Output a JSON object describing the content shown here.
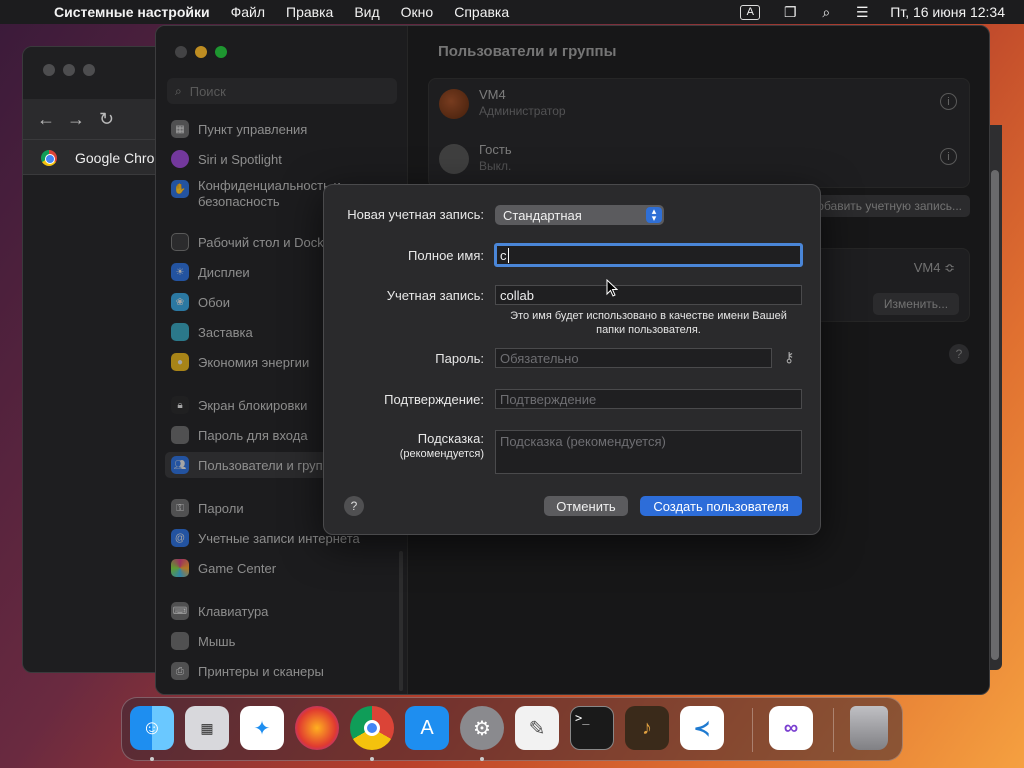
{
  "menubar": {
    "app_name": "Системные настройки",
    "items": [
      "Файл",
      "Правка",
      "Вид",
      "Окно",
      "Справка"
    ],
    "keyboard_badge": "A",
    "clock": "Пт, 16 июня  12:34"
  },
  "chrome_window": {
    "tab_title": "Google Chrom"
  },
  "sidebar": {
    "search_placeholder": "Поиск",
    "items": [
      {
        "label": "Пункт управления",
        "icon": "control-center-icon",
        "color": "#6b6b6d"
      },
      {
        "label": "Siri и Spotlight",
        "icon": "siri-icon",
        "color": "#9a4bd0"
      },
      {
        "label": "Конфиденциальность и",
        "label2": "безопасность",
        "icon": "hand-icon",
        "color": "#2f6fd6"
      },
      {
        "label": "Рабочий стол и Dock",
        "icon": "desktop-icon",
        "color": "#3a3a3c"
      },
      {
        "label": "Дисплеи",
        "icon": "display-icon",
        "color": "#2f6fd6"
      },
      {
        "label": "Обои",
        "icon": "wallpaper-icon",
        "color": "#3aa0d8"
      },
      {
        "label": "Заставка",
        "icon": "screensaver-icon",
        "color": "#3aa0b8"
      },
      {
        "label": "Экономия энергии",
        "icon": "energy-icon",
        "color": "#e0b020"
      },
      {
        "label": "Экран блокировки",
        "icon": "lock-icon",
        "color": "#2b2b2d"
      },
      {
        "label": "Пароль для входа",
        "icon": "login-password-icon",
        "color": "#6b6b6d"
      },
      {
        "label": "Пользователи и группы",
        "icon": "users-icon",
        "color": "#2f6fd6"
      },
      {
        "label": "Пароли",
        "icon": "key-icon",
        "color": "#6b6b6d"
      },
      {
        "label": "Учетные записи интернета",
        "icon": "at-icon",
        "color": "#2f6fd6"
      },
      {
        "label": "Game Center",
        "icon": "game-center-icon",
        "color": "#d04080"
      },
      {
        "label": "Клавиатура",
        "icon": "keyboard-icon",
        "color": "#6b6b6d"
      },
      {
        "label": "Мышь",
        "icon": "mouse-icon",
        "color": "#6b6b6d"
      },
      {
        "label": "Принтеры и сканеры",
        "icon": "printer-icon",
        "color": "#6b6b6d"
      }
    ]
  },
  "main": {
    "title": "Пользователи и группы",
    "users": [
      {
        "name": "VM4",
        "role": "Администратор"
      },
      {
        "name": "Гость",
        "role": "Выкл."
      }
    ],
    "add_account_label": "Добавить учетную запись...",
    "autologin_value": "VM4 ≎",
    "edit_button": "Изменить..."
  },
  "dialog": {
    "account_type_label": "Новая учетная запись:",
    "account_type_value": "Стандартная",
    "full_name_label": "Полное имя:",
    "full_name_value": "c",
    "account_name_label": "Учетная запись:",
    "account_name_value": "collab",
    "account_note": "Это имя будет использовано в качестве имени Вашей папки пользователя.",
    "password_label": "Пароль:",
    "password_placeholder": "Обязательно",
    "verify_label": "Подтверждение:",
    "verify_placeholder": "Подтверждение",
    "hint_label": "Подсказка:",
    "hint_sublabel": "(рекомендуется)",
    "hint_placeholder": "Подсказка (рекомендуется)",
    "help_label": "?",
    "cancel_label": "Отменить",
    "create_label": "Создать пользователя"
  },
  "dock": {
    "apps": [
      {
        "name": "finder-icon",
        "color": "#1e8ef0"
      },
      {
        "name": "launchpad-icon",
        "color": "#d8d8dc"
      },
      {
        "name": "safari-icon",
        "color": "#ffffff"
      },
      {
        "name": "firefox-icon",
        "color": "#7b2fd8"
      },
      {
        "name": "chrome-icon",
        "color": "#ffffff"
      },
      {
        "name": "app-store-icon",
        "color": "#1e8ef0"
      },
      {
        "name": "system-settings-icon",
        "color": "#8a8a8e"
      },
      {
        "name": "textedit-icon",
        "color": "#f2f2f2"
      },
      {
        "name": "terminal-icon",
        "color": "#1a1a1a"
      },
      {
        "name": "garageband-icon",
        "color": "#3a2a1a"
      },
      {
        "name": "vscode-icon",
        "color": "#ffffff"
      },
      {
        "name": "visual-studio-icon",
        "color": "#ffffff"
      },
      {
        "name": "trash-icon",
        "color": "#a0a0a4"
      }
    ]
  }
}
